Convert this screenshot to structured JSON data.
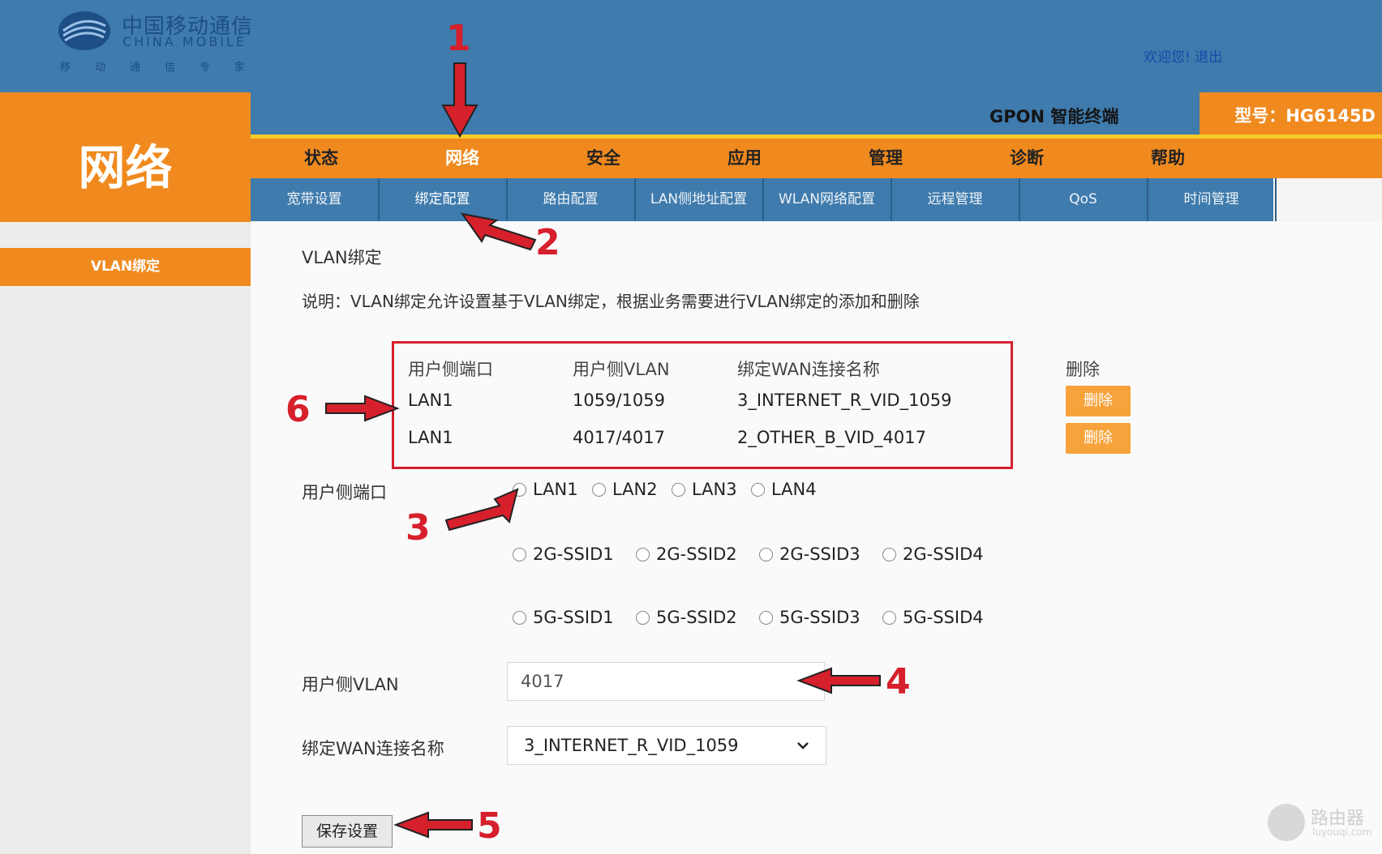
{
  "header": {
    "logo_cn": "中国移动通信",
    "logo_en": "CHINA MOBILE",
    "logo_slogan": "移动通信专家",
    "welcome": "欢迎您!",
    "logout": "退出",
    "product": "GPON 智能终端",
    "model": "型号：HG6145D"
  },
  "page_title": "网络",
  "main_nav": [
    "状态",
    "网络",
    "安全",
    "应用",
    "管理",
    "诊断",
    "帮助"
  ],
  "sub_nav": [
    "宽带设置",
    "绑定配置",
    "路由配置",
    "LAN侧地址配置",
    "WLAN网络配置",
    "远程管理",
    "QoS",
    "时间管理"
  ],
  "sidebar": {
    "item": "VLAN绑定"
  },
  "section": {
    "title": "VLAN绑定",
    "description": "说明：VLAN绑定允许设置基于VLAN绑定，根据业务需要进行VLAN绑定的添加和删除"
  },
  "table": {
    "headers": [
      "用户侧端口",
      "用户侧VLAN",
      "绑定WAN连接名称",
      "删除"
    ],
    "rows": [
      {
        "port": "LAN1",
        "vlan": "1059/1059",
        "wan": "3_INTERNET_R_VID_1059",
        "delete": "删除"
      },
      {
        "port": "LAN1",
        "vlan": "4017/4017",
        "wan": "2_OTHER_B_VID_4017",
        "delete": "删除"
      }
    ]
  },
  "form": {
    "port_label": "用户侧端口",
    "ports_lan": [
      "LAN1",
      "LAN2",
      "LAN3",
      "LAN4"
    ],
    "ports_2g": [
      "2G-SSID1",
      "2G-SSID2",
      "2G-SSID3",
      "2G-SSID4"
    ],
    "ports_5g": [
      "5G-SSID1",
      "5G-SSID2",
      "5G-SSID3",
      "5G-SSID4"
    ],
    "vlan_label": "用户侧VLAN",
    "vlan_value": "4017",
    "wan_label": "绑定WAN连接名称",
    "wan_selected": "3_INTERNET_R_VID_1059",
    "save": "保存设置"
  },
  "annotations": [
    "1",
    "2",
    "3",
    "4",
    "5",
    "6"
  ],
  "watermark": {
    "text": "路由器",
    "sub": "luyouqi.com"
  },
  "colors": {
    "header_blue": "#3f7bad",
    "orange": "#f08a1f",
    "annotation_red": "#d6202c",
    "delete_orange": "#f6a33b"
  }
}
